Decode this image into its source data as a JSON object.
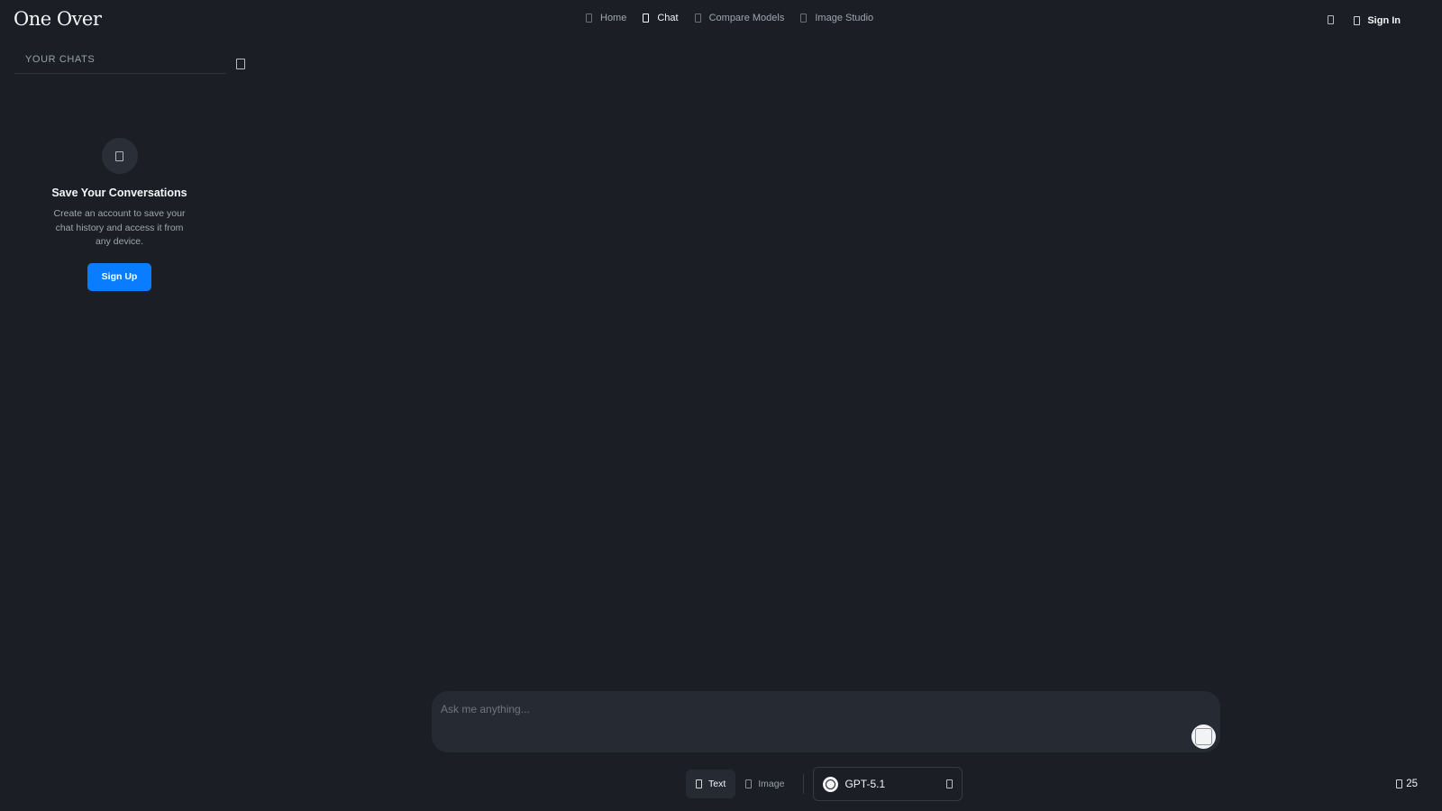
{
  "header": {
    "logo": "One Over",
    "nav": [
      {
        "label": "Home",
        "icon": "home-icon"
      },
      {
        "label": "Chat",
        "icon": "chat-icon"
      },
      {
        "label": "Compare Models",
        "icon": "compare-icon"
      },
      {
        "label": "Image Studio",
        "icon": "image-icon"
      }
    ],
    "active_nav": "Chat",
    "sign_in": "Sign In",
    "theme_icon": "theme-toggle-icon",
    "sign_in_icon": "user-icon"
  },
  "sidebar": {
    "title": "YOUR CHATS",
    "toggle_icon": "sidebar-toggle-icon",
    "empty_state": {
      "icon": "chat-bubble-icon",
      "title": "Save Your Conversations",
      "description": "Create an account to save your chat history and access it from any device.",
      "button": "Sign Up"
    }
  },
  "composer": {
    "placeholder": "Ask me anything...",
    "value": "",
    "send_icon": "send-icon"
  },
  "controls": {
    "modes": [
      {
        "label": "Text",
        "icon": "text-icon"
      },
      {
        "label": "Image",
        "icon": "image-icon"
      }
    ],
    "active_mode": "Text",
    "model": {
      "name": "GPT-5.1",
      "logo": "openai-logo-icon",
      "chevron": "chevron-down-icon"
    }
  },
  "credits": {
    "count": "25",
    "icon": "credits-icon"
  },
  "colors": {
    "background": "#1b1e25",
    "surface": "#262a33",
    "accent": "#0a7cff",
    "text": "#f4f5f7",
    "muted": "#9aa0aa"
  }
}
